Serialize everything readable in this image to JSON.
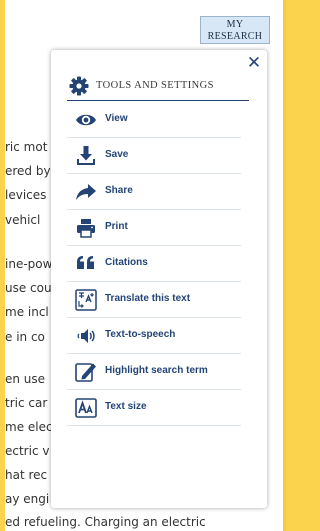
{
  "header": {
    "my_research_line1": "MY",
    "my_research_line2": "RESEARCH"
  },
  "article": {
    "lines": [
      "ric mot",
      "ered by",
      "levices",
      "vehicl",
      "ine-pow",
      "use cou",
      "me incl",
      "e in co",
      "en use",
      "tric car",
      "me elec",
      "ectric v",
      "hat rec",
      "ay engi",
      "ed refueling. Charging an electric"
    ]
  },
  "panel": {
    "title": "TOOLS AND SETTINGS",
    "items": [
      {
        "label": "View",
        "icon": "eye-icon"
      },
      {
        "label": "Save",
        "icon": "download-icon"
      },
      {
        "label": "Share",
        "icon": "share-arrow-icon"
      },
      {
        "label": "Print",
        "icon": "printer-icon"
      },
      {
        "label": "Citations",
        "icon": "quote-icon"
      },
      {
        "label": "Translate this text",
        "icon": "translate-icon"
      },
      {
        "label": "Text-to-speech",
        "icon": "speaker-icon"
      },
      {
        "label": "Highlight search term",
        "icon": "highlighter-icon"
      },
      {
        "label": "Text size",
        "icon": "text-size-icon"
      }
    ]
  },
  "colors": {
    "accent": "#244476",
    "background": "#fbd34d",
    "button_bg": "#d7e7f5"
  }
}
